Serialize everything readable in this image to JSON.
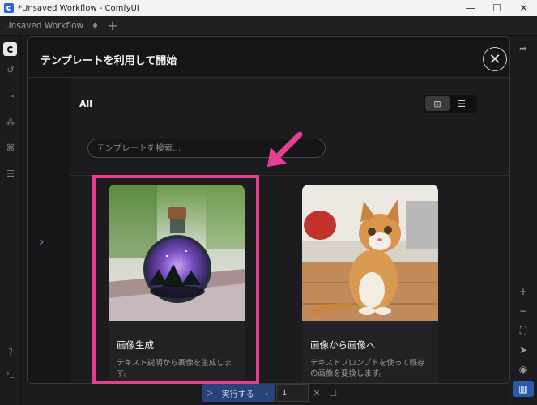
{
  "window": {
    "title": "*Unsaved Workflow - ComfyUI",
    "minimize": "—",
    "maximize": "☐",
    "close": "✕"
  },
  "tabs": [
    {
      "label": "Unsaved Workflow"
    }
  ],
  "tab_add": "+",
  "modal": {
    "title": "テンプレートを利用して開始",
    "close": "✕",
    "category": "All",
    "search_placeholder": "テンプレートを検索...",
    "expand": "›",
    "cards": [
      {
        "title": "画像生成",
        "description": "テキスト説明から画像を生成します。"
      },
      {
        "title": "画像から画像へ",
        "description": "テキストプロンプトを使って既存の画像を変換します。"
      }
    ]
  },
  "runbar": {
    "run_label": "実行する",
    "run_icon": "▷",
    "dropdown": "⌄",
    "count": "1"
  },
  "colors": {
    "accent": "#2d5aa8",
    "highlight": "#e53f93",
    "modal_bg": "#161618"
  },
  "icons": {
    "sidebar": [
      "history-icon",
      "queue-icon",
      "node-library-icon",
      "model-library-icon",
      "workflows-icon",
      "help-icon",
      "terminal-icon"
    ],
    "rightbar": [
      "zoom-in-icon",
      "zoom-out-icon",
      "fit-view-icon",
      "select-tool-icon",
      "visibility-icon",
      "minimap-icon"
    ]
  }
}
